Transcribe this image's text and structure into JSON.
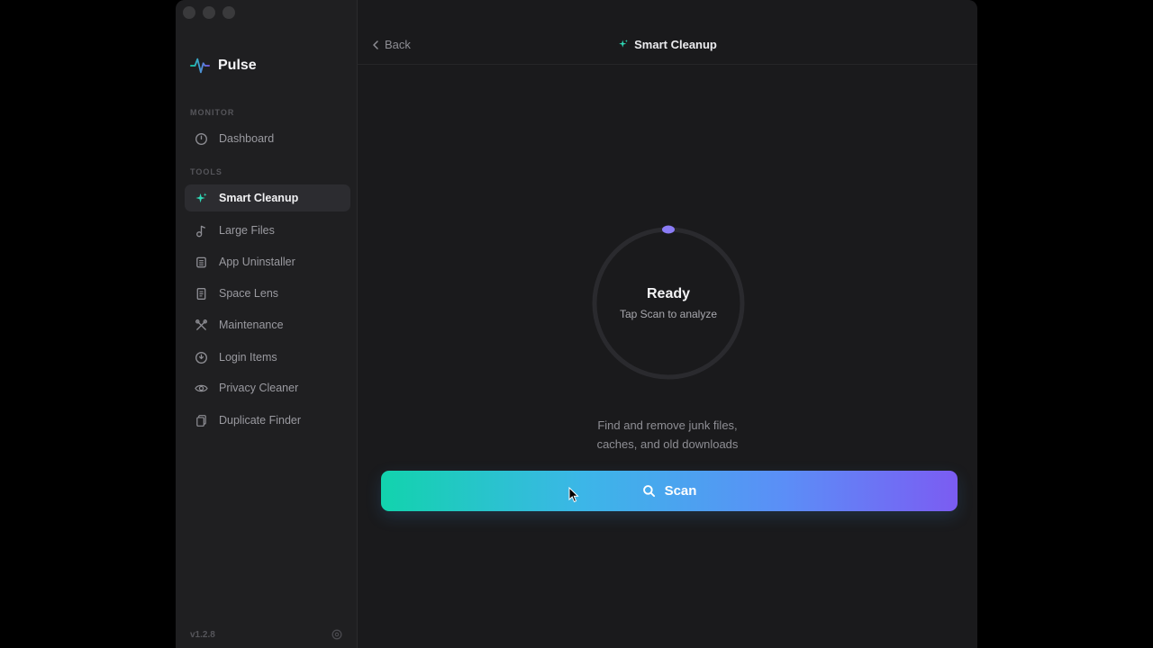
{
  "app": {
    "name": "Pulse",
    "version": "v1.2.8"
  },
  "sidebar": {
    "sections": [
      {
        "label": "MONITOR"
      },
      {
        "label": "TOOLS"
      }
    ],
    "items": [
      {
        "label": "Dashboard",
        "icon": "gauge-icon"
      },
      {
        "label": "Smart Cleanup",
        "icon": "sparkle-icon",
        "active": true
      },
      {
        "label": "Large Files",
        "icon": "music-file-icon"
      },
      {
        "label": "App Uninstaller",
        "icon": "trash-box-icon"
      },
      {
        "label": "Space Lens",
        "icon": "document-icon"
      },
      {
        "label": "Maintenance",
        "icon": "wrench-icon"
      },
      {
        "label": "Login Items",
        "icon": "power-icon"
      },
      {
        "label": "Privacy Cleaner",
        "icon": "eye-icon"
      },
      {
        "label": "Duplicate Finder",
        "icon": "copy-icon"
      }
    ]
  },
  "header": {
    "back_label": "Back",
    "title": "Smart Cleanup"
  },
  "scanner": {
    "status": "Ready",
    "subtitle": "Tap Scan to analyze",
    "description_line1": "Find and remove junk files,",
    "description_line2": "caches, and old downloads",
    "button_label": "Scan"
  },
  "colors": {
    "accent_teal": "#12d3ad",
    "accent_purple": "#7b5cf2",
    "ring_dot": "#8b7cf6",
    "background": "#1a1a1c"
  }
}
